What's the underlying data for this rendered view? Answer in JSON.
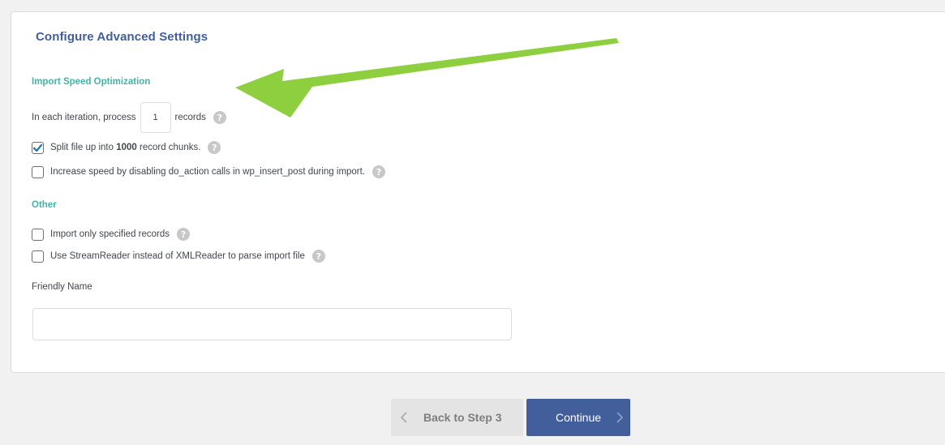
{
  "panel": {
    "title": "Configure Advanced Settings",
    "speed_section": {
      "heading": "Import Speed Optimization",
      "iteration_prefix": "In each iteration, process",
      "iteration_value": "1",
      "iteration_suffix": "records",
      "split_checkbox": {
        "checked": true,
        "label_before": "Split file up into",
        "chunk_size": "1000",
        "label_after": "record chunks."
      },
      "disable_do_action": {
        "checked": false,
        "label": "Increase speed by disabling do_action calls in wp_insert_post during import."
      }
    },
    "other_section": {
      "heading": "Other",
      "import_specified": {
        "checked": false,
        "label": "Import only specified records"
      },
      "stream_reader": {
        "checked": false,
        "label": "Use StreamReader instead of XMLReader to parse import file"
      }
    },
    "friendly_name": {
      "label": "Friendly Name",
      "value": ""
    }
  },
  "footer": {
    "back_label": "Back to Step 3",
    "continue_label": "Continue"
  },
  "colors": {
    "title": "#425f9c",
    "section_heading": "#46b3a9",
    "continue_button": "#425f9c",
    "annotation_arrow": "#8dcf3f"
  },
  "icons": {
    "help": "help-icon",
    "back": "chevron-left-icon",
    "continue": "chevron-right-icon",
    "check": "checkmark-icon"
  }
}
